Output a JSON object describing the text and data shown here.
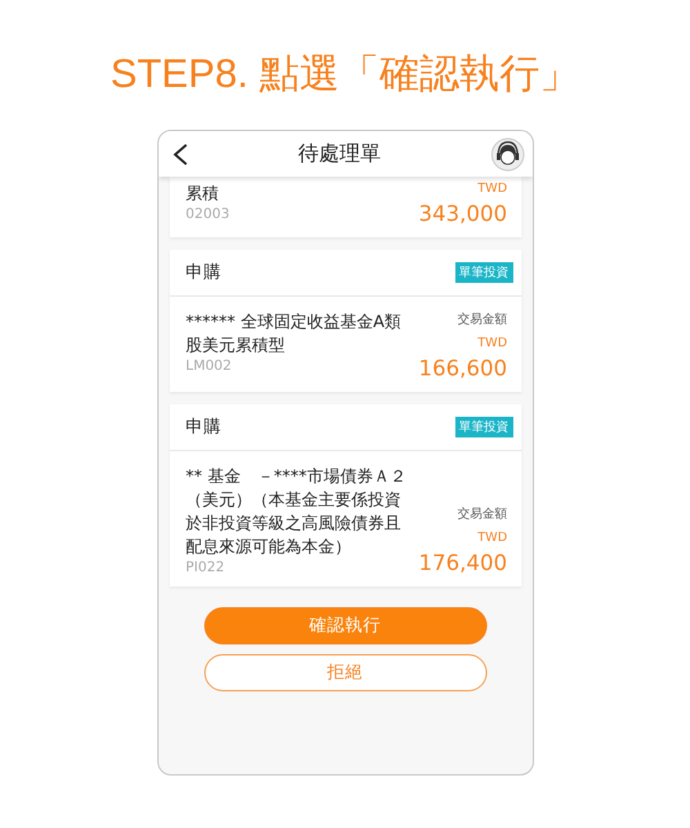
{
  "step_title": "STEP8. 點選「確認執行」",
  "screen": {
    "title": "待處理單",
    "orders": [
      {
        "name": "累積",
        "code": "02003",
        "currency": "TWD",
        "amount": "343,000"
      },
      {
        "type": "申購",
        "badge": "單筆投資",
        "name": "****** 全球固定收益基金A類股美元累積型",
        "code": "LM002",
        "amount_label": "交易金額",
        "currency": "TWD",
        "amount": "166,600"
      },
      {
        "type": "申購",
        "badge": "單筆投資",
        "name": "** 基金　－****市場債券Ａ２（美元）（本基金主要係投資於非投資等級之高風險債券且配息來源可能為本金）",
        "code": "PI022",
        "amount_label": "交易金額",
        "currency": "TWD",
        "amount": "176,400"
      }
    ],
    "buttons": [
      {
        "label": "確認執行",
        "kind": "primary"
      },
      {
        "label": "拒絕",
        "kind": "secondary"
      }
    ]
  }
}
